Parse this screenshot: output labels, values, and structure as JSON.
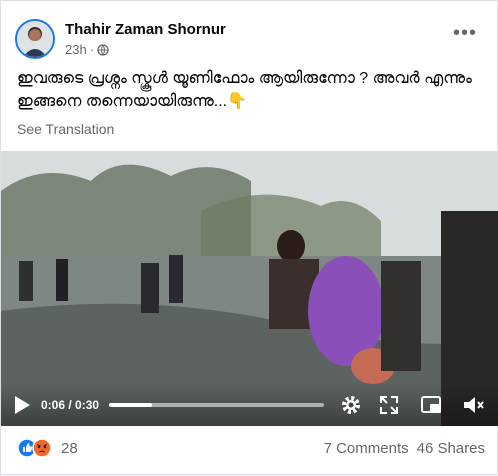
{
  "post": {
    "author": "Thahir Zaman Shornur",
    "time": "23h",
    "separator": "·",
    "privacy_icon": "globe-icon",
    "more_icon": "more-horizontal-icon",
    "more_label": "•••",
    "text": "ഇവരുടെ പ്രശ്നം സ്കൂൾ യൂണിഫോം ആയിരുന്നോ ?  അവർ എന്നും ഇങ്ങനെ തന്നെയായിരുന്നു...",
    "emoji": "👇",
    "see_translation": "See Translation"
  },
  "video": {
    "current_time": "0:06",
    "duration": "0:30",
    "time_separator": " / ",
    "progress_fraction": 0.2,
    "icons": [
      "play-icon",
      "settings-icon",
      "fullscreen-icon",
      "picture-in-picture-icon",
      "volume-icon"
    ]
  },
  "footer": {
    "reaction_count": "28",
    "comments": "7 Comments",
    "shares": "46 Shares"
  },
  "colors": {
    "like_blue": "#1877f2",
    "angry_orange": "#f0692a",
    "secondary_text": "#65676b"
  }
}
